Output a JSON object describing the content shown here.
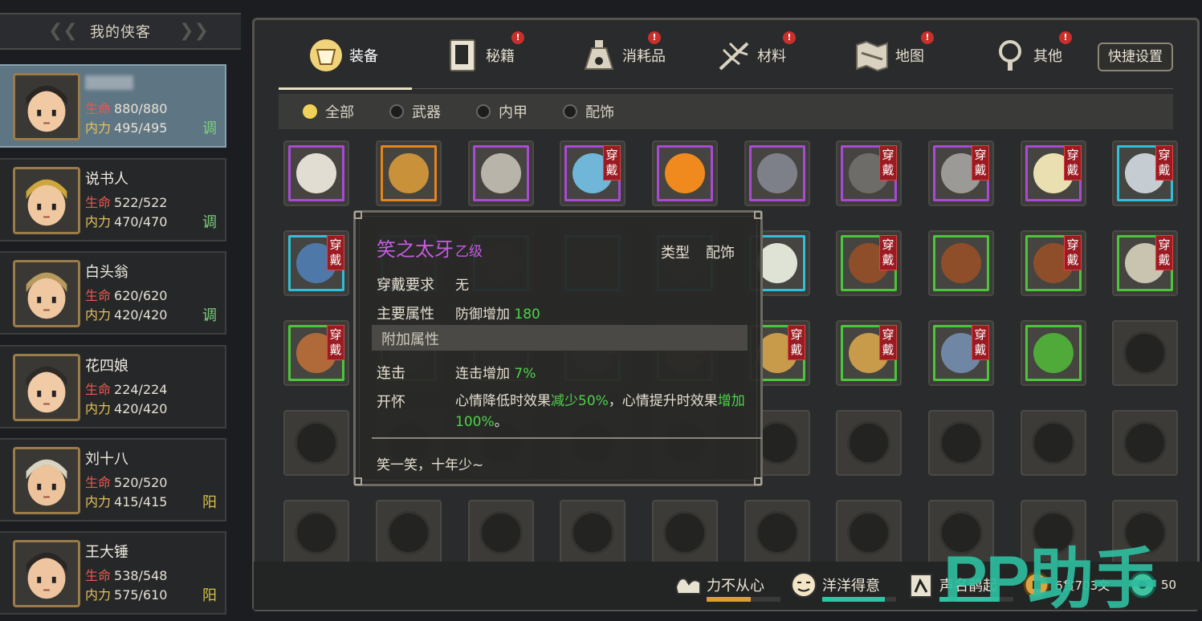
{
  "roster": {
    "title": "我的侠客",
    "heroes": [
      {
        "name": "",
        "hp_label": "生命",
        "hp": "880/880",
        "mp_label": "内力",
        "mp": "495/495",
        "mood": "调",
        "selected": true
      },
      {
        "name": "说书人",
        "hp_label": "生命",
        "hp": "522/522",
        "mp_label": "内力",
        "mp": "470/470",
        "mood": "调"
      },
      {
        "name": "白头翁",
        "hp_label": "生命",
        "hp": "620/620",
        "mp_label": "内力",
        "mp": "420/420",
        "mood": "调"
      },
      {
        "name": "花四娘",
        "hp_label": "生命",
        "hp": "224/224",
        "mp_label": "内力",
        "mp": "420/420",
        "mood": ""
      },
      {
        "name": "刘十八",
        "hp_label": "生命",
        "hp": "520/520",
        "mp_label": "内力",
        "mp": "415/415",
        "mood": "阳"
      },
      {
        "name": "王大锤",
        "hp_label": "生命",
        "hp": "538/548",
        "mp_label": "内力",
        "mp": "575/610",
        "mood": "阳"
      }
    ]
  },
  "tabs": [
    {
      "label": "装备",
      "icon": "armor-icon",
      "alert": false,
      "active": true
    },
    {
      "label": "秘籍",
      "icon": "book-icon",
      "alert": true
    },
    {
      "label": "消耗品",
      "icon": "potion-icon",
      "alert": true
    },
    {
      "label": "材料",
      "icon": "herb-icon",
      "alert": true
    },
    {
      "label": "地图",
      "icon": "map-icon",
      "alert": true
    },
    {
      "label": "其他",
      "icon": "lamp-icon",
      "alert": true
    }
  ],
  "alert_mark": "!",
  "quick_settings": "快捷设置",
  "filters": [
    {
      "label": "全部",
      "on": true
    },
    {
      "label": "武器",
      "on": false
    },
    {
      "label": "内甲",
      "on": false
    },
    {
      "label": "配饰",
      "on": false
    }
  ],
  "equip_tag": "穿戴",
  "item_rows": [
    [
      {
        "q": "purple",
        "icon": "pouch-icon"
      },
      {
        "q": "orange",
        "icon": "medallion-icon"
      },
      {
        "q": "purple",
        "icon": "spear-icon"
      },
      {
        "q": "purple",
        "icon": "sash-icon",
        "worn": true
      },
      {
        "q": "purple",
        "icon": "eye-amulet-icon"
      },
      {
        "q": "purple",
        "icon": "cape-icon"
      },
      {
        "q": "purple",
        "icon": "shield-icon",
        "worn": true
      },
      {
        "q": "purple",
        "icon": "axe-icon",
        "worn": true
      },
      {
        "q": "purple",
        "icon": "fang-icon",
        "worn": true
      },
      {
        "q": "cyan",
        "icon": "sword-icon",
        "worn": true
      }
    ],
    [
      {
        "q": "cyan",
        "icon": "vest-icon",
        "worn": true
      },
      {
        "q": "cyan",
        "icon": "ring-icon",
        "worn": true,
        "hidden": true
      },
      {
        "q": "cyan",
        "icon": "bag-icon",
        "hidden": true
      },
      {
        "q": "cyan",
        "icon": "flower-icon",
        "hidden": true
      },
      {
        "q": "cyan",
        "icon": "item-icon",
        "hidden": true
      },
      {
        "q": "cyan",
        "icon": "collar-icon"
      },
      {
        "q": "green",
        "icon": "glove-icon",
        "worn": true
      },
      {
        "q": "green",
        "icon": "glove-icon"
      },
      {
        "q": "green",
        "icon": "glove-icon",
        "worn": true
      },
      {
        "q": "green",
        "icon": "staff-icon",
        "worn": true
      }
    ],
    [
      {
        "q": "green",
        "icon": "club-icon",
        "worn": true
      },
      {
        "q": "green",
        "icon": "item-icon",
        "hidden": true
      },
      {
        "q": "green",
        "icon": "item-icon",
        "hidden": true
      },
      {
        "q": "green",
        "icon": "spear-icon",
        "worn": true,
        "hidden": true
      },
      {
        "q": "green",
        "icon": "robe-icon",
        "worn": true,
        "hidden": true
      },
      {
        "q": "green",
        "icon": "robe-icon",
        "worn": true
      },
      {
        "q": "green",
        "icon": "robe-icon",
        "worn": true
      },
      {
        "q": "green",
        "icon": "armor-icon",
        "worn": true
      },
      {
        "q": "green",
        "icon": "herb-icon"
      },
      {
        "q": "empty"
      }
    ],
    [
      {
        "q": "empty"
      },
      {
        "q": "empty"
      },
      {
        "q": "empty"
      },
      {
        "q": "empty"
      },
      {
        "q": "empty"
      },
      {
        "q": "empty"
      },
      {
        "q": "empty"
      },
      {
        "q": "empty"
      },
      {
        "q": "empty"
      },
      {
        "q": "empty"
      }
    ],
    [
      {
        "q": "empty"
      },
      {
        "q": "empty"
      },
      {
        "q": "empty"
      },
      {
        "q": "empty"
      },
      {
        "q": "empty"
      },
      {
        "q": "empty"
      },
      {
        "q": "empty"
      },
      {
        "q": "empty"
      },
      {
        "q": "empty"
      },
      {
        "q": "empty"
      }
    ]
  ],
  "tooltip": {
    "name": "笑之太牙",
    "grade": "乙级",
    "type_label": "类型",
    "type_value": "配饰",
    "req_label": "穿戴要求",
    "req_value": "无",
    "main_label": "主要属性",
    "main_value": "防御增加",
    "main_num": "180",
    "extra_header": "附加属性",
    "extras": [
      {
        "label": "连击",
        "value": "连击增加",
        "num": "7%"
      },
      {
        "label": "开怀",
        "value_a": "心情降低时效果",
        "num_a": "减少50%",
        "value_b": "，心情提升时效果",
        "num_b": "增加100%",
        "value_c": "。"
      }
    ],
    "desc": "笑一笑，十年少~"
  },
  "status": [
    {
      "label": "力不从心",
      "icon": "muscle-icon",
      "level": 0.6,
      "color": "#d7a12a"
    },
    {
      "label": "洋洋得意",
      "icon": "smile-icon",
      "level": 0.85,
      "color": "#2ec4a4"
    },
    {
      "label": "声名鹊起",
      "icon": "fame-icon",
      "level": 0.8,
      "color": "#2ec4a4"
    }
  ],
  "money": "6贯703文",
  "jade": "50",
  "watermark": "PP助手",
  "colors": {
    "purple": "#a74bd3",
    "orange": "#e3861f",
    "cyan": "#2fc0d8",
    "green": "#4cc53c",
    "equip_tag": "#9b1b22"
  }
}
